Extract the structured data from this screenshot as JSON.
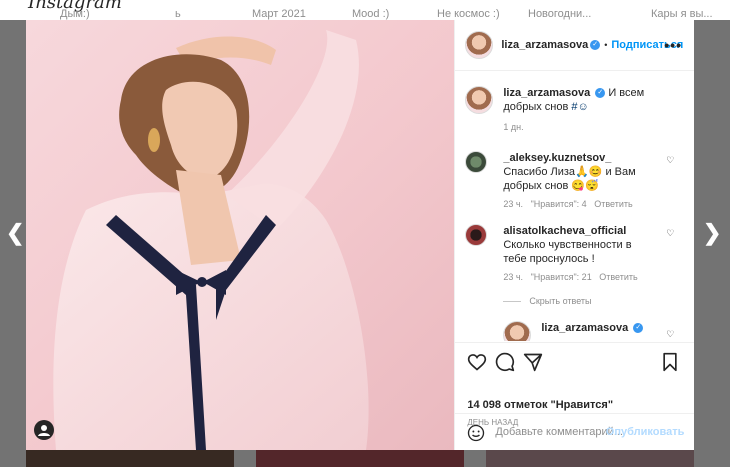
{
  "background": {
    "logo": "Instagram",
    "top_labels": [
      "Дым:)",
      "ь",
      "Март 2021",
      "Mood :)",
      "Не космос :)",
      "Новогодни...",
      "Кары я вы..."
    ]
  },
  "post": {
    "username": "liza_arzamasova",
    "follow_label": "Подписаться",
    "separator": "•",
    "more_label": "•••",
    "caption": "И всем добрых снов",
    "caption_tail": "#☺",
    "caption_age": "1 дн."
  },
  "comments": [
    {
      "username": "_aleksey.kuznetsov_",
      "text": "Спасибо Лиза🙏😊 и Вам добрых снов 😋😴",
      "age": "23 ч.",
      "likes": "\"Нравится\": 4",
      "reply": "Ответить"
    },
    {
      "username": "alisatolkacheva_official",
      "text": "Сколько чувственности в тебе проснулось !",
      "age": "23 ч.",
      "likes": "\"Нравится\": 21",
      "reply": "Ответить"
    }
  ],
  "hide_replies": "Скрыть ответы",
  "reply_user": "liza_arzamasova",
  "likes_count": "14 098 отметок \"Нравится\"",
  "posted_ago": "ДЕНЬ НАЗАД",
  "comment_placeholder": "Добавьте комментарий...",
  "publish_label": "Опубликовать",
  "colors": {
    "accent": "#0095f6",
    "verified": "#3897f0",
    "photo_bg": "#f5d2d6"
  }
}
